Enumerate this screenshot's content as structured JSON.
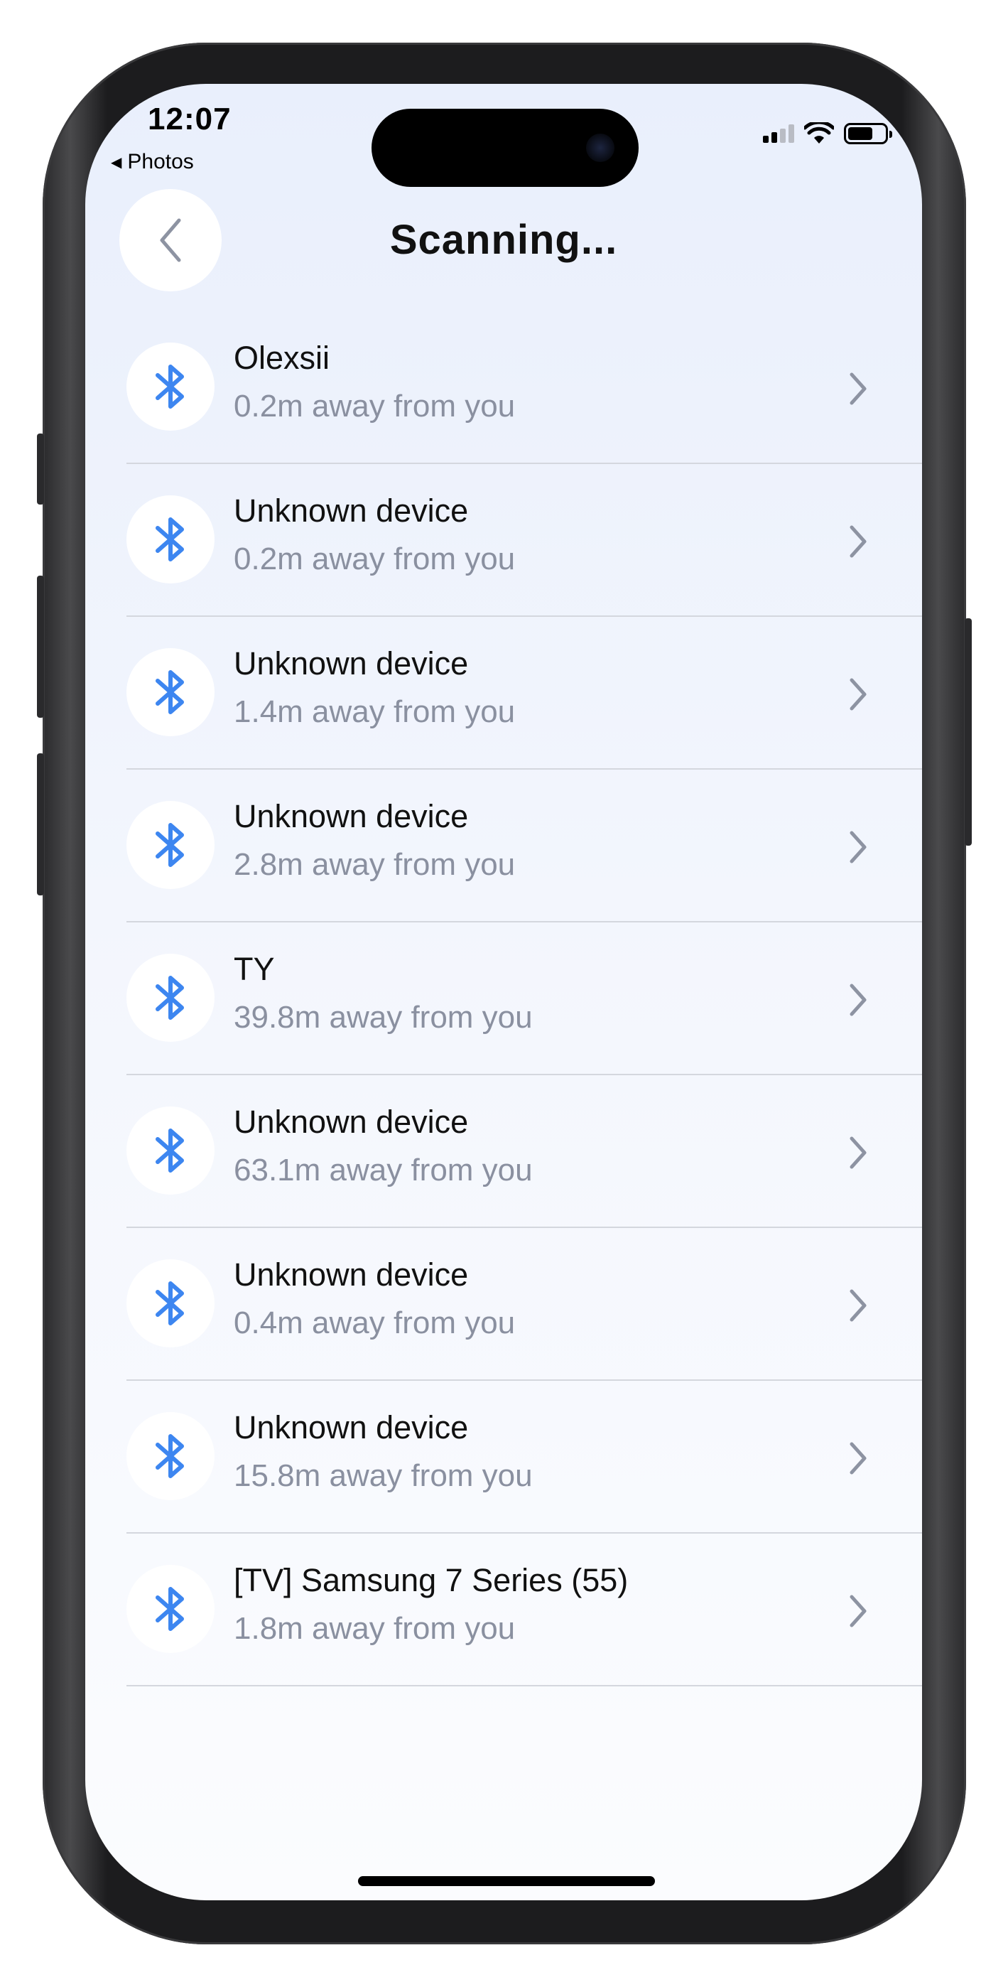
{
  "status_bar": {
    "time": "12:07",
    "back_app": "Photos"
  },
  "header": {
    "title": "Scanning..."
  },
  "devices": [
    {
      "name": "Olexsii",
      "distance": "0.2m away from you"
    },
    {
      "name": "Unknown device",
      "distance": "0.2m away from you"
    },
    {
      "name": "Unknown device",
      "distance": "1.4m away from you"
    },
    {
      "name": "Unknown device",
      "distance": "2.8m away from you"
    },
    {
      "name": "TY",
      "distance": "39.8m away from you"
    },
    {
      "name": "Unknown device",
      "distance": "63.1m away from you"
    },
    {
      "name": "Unknown device",
      "distance": "0.4m away from you"
    },
    {
      "name": "Unknown device",
      "distance": "15.8m away from you"
    },
    {
      "name": "[TV] Samsung 7 Series (55)",
      "distance": "1.8m away from you"
    }
  ],
  "icons": {
    "device": "bluetooth-icon",
    "row_action": "chevron-right-icon",
    "back": "chevron-left-icon"
  },
  "colors": {
    "accent": "#3d86f0",
    "secondary_text": "#8a90a0",
    "chevron": "#8d93a2"
  }
}
